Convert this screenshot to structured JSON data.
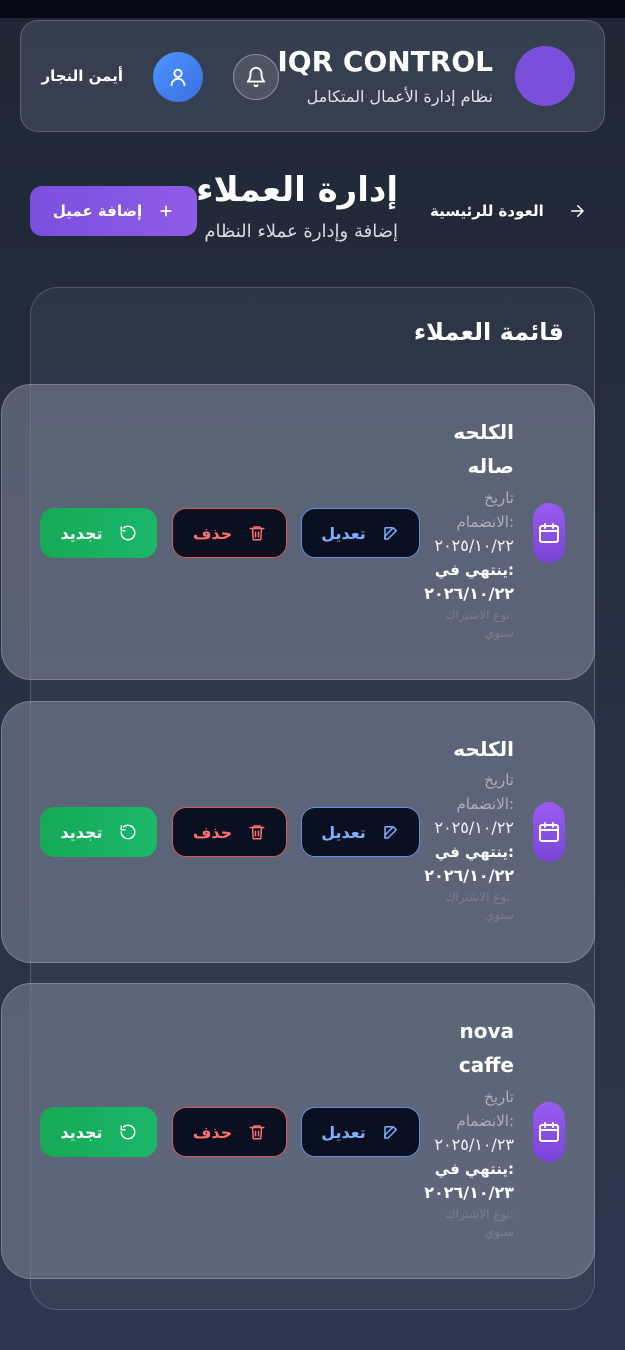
{
  "header": {
    "brand_title": "IQR CONTROL",
    "brand_subtitle": "نظام إدارة الأعمال المتكامل",
    "user_name": "أيمن النجار"
  },
  "page": {
    "back_label": "العودة للرئيسية",
    "title": "إدارة العملاء",
    "subtitle": "إضافة وإدارة عملاء النظام",
    "add_button_label": "إضافة عميل"
  },
  "list": {
    "title": "قائمة العملاء",
    "join_label_1": "تاريخ",
    "join_label_2": "الانضمام:",
    "expiry_label": "ينتهي في:",
    "edit_label": "تعديل",
    "delete_label": "حذف",
    "renew_label": "تجديد",
    "clients": [
      {
        "name_line1": "الكلحه",
        "name_line2": "صاله",
        "join_date": "٢٠٢٥/١٠/٢٢",
        "expiry_date": "٢٠٢٦/١٠/٢٢",
        "faint_1": "نوع الاشتراك:",
        "faint_2": "سنوي"
      },
      {
        "name_line1": "الكلحه",
        "name_line2": "",
        "join_date": "٢٠٢٥/١٠/٢٢",
        "expiry_date": "٢٠٢٦/١٠/٢٢",
        "faint_1": "نوع الاشتراك:",
        "faint_2": "سنوي"
      },
      {
        "name_line1": "nova",
        "name_line2": "caffe",
        "join_date": "٢٠٢٥/١٠/٢٣",
        "expiry_date": "٢٠٢٦/١٠/٢٣",
        "faint_1": "نوع الاشتراك:",
        "faint_2": "سنوي"
      }
    ]
  }
}
